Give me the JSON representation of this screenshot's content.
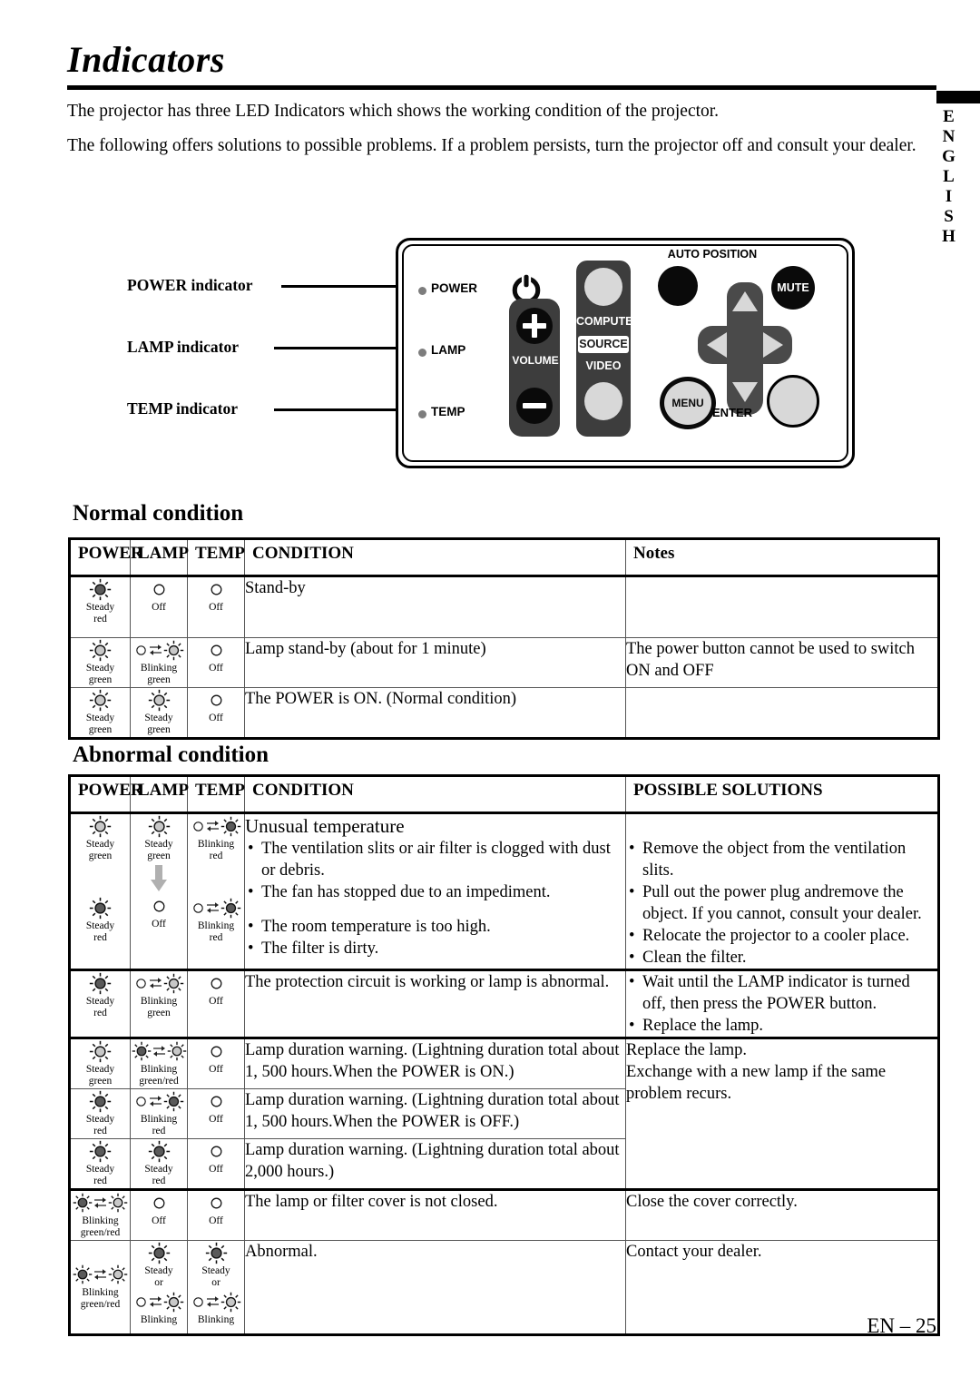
{
  "page": {
    "title": "Indicators",
    "intro1": "The projector has three LED Indicators which shows the working condition of the projector.",
    "intro2": "The following offers solutions to possible problems. If a problem persists, turn the projector off and consult your dealer.",
    "side_tab": "ENGLISH",
    "footer": "EN – 25"
  },
  "diagram": {
    "callouts": [
      {
        "label": "POWER indicator"
      },
      {
        "label": "LAMP indicator"
      },
      {
        "label": "TEMP indicator"
      }
    ],
    "panel": {
      "indicator_labels": [
        "POWER",
        "LAMP",
        "TEMP"
      ],
      "power_button": "power-symbol",
      "volume_label": "VOLUME",
      "volume_up": "+",
      "volume_down": "−",
      "computer_label": "COMPUTER",
      "source_label": "SOURCE",
      "video_label": "VIDEO",
      "auto_position_label": "AUTO POSITION",
      "mute_label": "MUTE",
      "menu_label": "MENU",
      "enter_label": "ENTER"
    }
  },
  "normal": {
    "heading": "Normal condition",
    "headers": [
      "POWER",
      "LAMP",
      "TEMP",
      "CONDITION",
      "Notes"
    ],
    "rows": [
      {
        "power": {
          "type": "steady",
          "color": "red",
          "label1": "Steady",
          "label2": "red"
        },
        "lamp": {
          "type": "off",
          "label1": "Off",
          "label2": ""
        },
        "temp": {
          "type": "off",
          "label1": "Off",
          "label2": ""
        },
        "condition": "Stand-by",
        "notes": ""
      },
      {
        "power": {
          "type": "steady",
          "color": "green",
          "label1": "Steady",
          "label2": "green"
        },
        "lamp": {
          "type": "blinking",
          "color": "green",
          "label1": "Blinking",
          "label2": "green"
        },
        "temp": {
          "type": "off",
          "label1": "Off",
          "label2": ""
        },
        "condition": "Lamp stand-by (about for 1 minute)",
        "notes": "The power button cannot be used to switch ON and OFF"
      },
      {
        "power": {
          "type": "steady",
          "color": "green",
          "label1": "Steady",
          "label2": "green"
        },
        "lamp": {
          "type": "steady",
          "color": "green",
          "label1": "Steady",
          "label2": "green"
        },
        "temp": {
          "type": "off",
          "label1": "Off",
          "label2": ""
        },
        "condition": "The POWER is ON. (Normal condition)",
        "notes": ""
      }
    ]
  },
  "abnormal": {
    "heading": "Abnormal condition",
    "headers": [
      "POWER",
      "LAMP",
      "TEMP",
      "CONDITION",
      "POSSIBLE SOLUTIONS"
    ],
    "rows": [
      {
        "power_top": {
          "type": "steady",
          "color": "green",
          "label1": "Steady",
          "label2": "green"
        },
        "power_bot": {
          "type": "steady",
          "color": "red",
          "label1": "Steady",
          "label2": "red"
        },
        "lamp_top": {
          "type": "steady",
          "color": "green",
          "label1": "Steady",
          "label2": "green"
        },
        "lamp_bot": {
          "type": "off",
          "label1": "Off",
          "label2": ""
        },
        "temp_top": {
          "type": "blinking",
          "color": "red",
          "label1": "Blinking",
          "label2": "red"
        },
        "temp_bot": {
          "type": "blinking",
          "color": "red",
          "label1": "Blinking",
          "label2": "red"
        },
        "condition_title": "Unusual temperature",
        "condition_bullets_top": [
          "The ventilation slits or air filter is clogged with dust or debris.",
          "The fan has stopped due to an impediment."
        ],
        "condition_bullets_bot": [
          "The room temperature is too high.",
          "The filter is dirty."
        ],
        "solutions": [
          "Remove the object from the ventilation slits.",
          "Pull out the power plug andremove the object. If you cannot, consult your dealer.",
          "Relocate the projector to a cooler place.",
          "Clean the filter."
        ]
      },
      {
        "power": {
          "type": "steady",
          "color": "red",
          "label1": "Steady",
          "label2": "red"
        },
        "lamp": {
          "type": "blinking",
          "color": "green",
          "label1": "Blinking",
          "label2": "green"
        },
        "temp": {
          "type": "off",
          "label1": "Off",
          "label2": ""
        },
        "condition": "The protection circuit is working or lamp is abnormal.",
        "solutions": [
          "Wait until the LAMP indicator is turned off, then press the POWER button.",
          "Replace the lamp."
        ]
      },
      {
        "power": {
          "type": "steady",
          "color": "green",
          "label1": "Steady",
          "label2": "green"
        },
        "lamp": {
          "type": "blinking2",
          "color": "green/red",
          "label1": "Blinking",
          "label2": "green/red"
        },
        "temp": {
          "type": "off",
          "label1": "Off",
          "label2": ""
        },
        "condition": "Lamp duration warning. (Lightning duration total about 1, 500 hours.When the POWER is ON.)",
        "solutions_block": "Replace the lamp.\nExchange with a new lamp if the same problem recurs."
      },
      {
        "power": {
          "type": "steady",
          "color": "red",
          "label1": "Steady",
          "label2": "red"
        },
        "lamp": {
          "type": "blinking",
          "color": "red",
          "label1": "Blinking",
          "label2": "red"
        },
        "temp": {
          "type": "off",
          "label1": "Off",
          "label2": ""
        },
        "condition": "Lamp duration warning. (Lightning duration total about 1, 500 hours.When the POWER is OFF.)"
      },
      {
        "power": {
          "type": "steady",
          "color": "red",
          "label1": "Steady",
          "label2": "red"
        },
        "lamp": {
          "type": "steady",
          "color": "red",
          "label1": "Steady",
          "label2": "red"
        },
        "temp": {
          "type": "off",
          "label1": "Off",
          "label2": ""
        },
        "condition": "Lamp duration warning. (Lightning duration total about 2,000 hours.)"
      },
      {
        "power": {
          "type": "blinking2",
          "color": "green/red",
          "label1": "Blinking",
          "label2": "green/red"
        },
        "lamp": {
          "type": "off",
          "label1": "Off",
          "label2": ""
        },
        "temp": {
          "type": "off",
          "label1": "Off",
          "label2": ""
        },
        "condition": "The lamp or filter cover is not closed.",
        "solutions_block": "Close the cover correctly."
      },
      {
        "power": {
          "type": "blinking2",
          "color": "green/red",
          "label1": "Blinking",
          "label2": "green/red"
        },
        "lamp_top": {
          "type": "steady",
          "color": "red",
          "label1": "Steady",
          "label2": "or"
        },
        "lamp_bot": {
          "type": "blinking",
          "color": "green",
          "label1": "Blinking",
          "label2": ""
        },
        "temp_top": {
          "type": "steady",
          "color": "red",
          "label1": "Steady",
          "label2": "or"
        },
        "temp_bot": {
          "type": "blinking",
          "color": "green",
          "label1": "Blinking",
          "label2": ""
        },
        "condition": "Abnormal.",
        "solutions_block": "Contact your dealer."
      }
    ]
  }
}
